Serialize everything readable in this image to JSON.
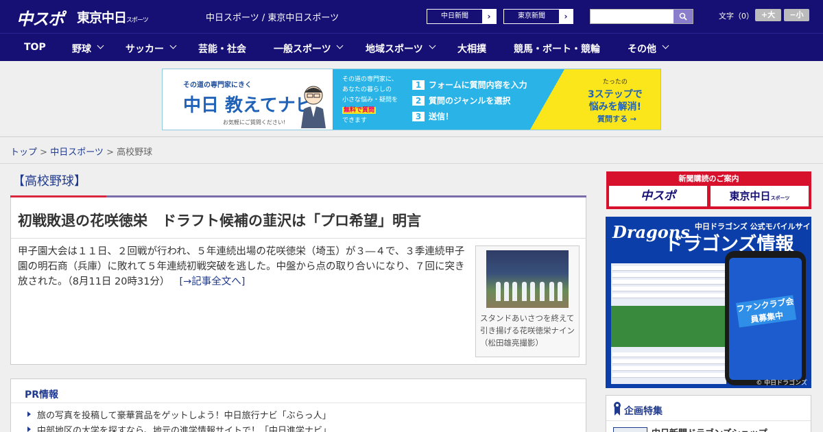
{
  "header": {
    "logo_chunichi": "中スポ",
    "logo_tokyo": "東京中日",
    "logo_tokyo_small": "スポーツ",
    "site_links": "中日スポーツ / 東京中日スポーツ",
    "paper_links": [
      {
        "label": "中日新聞",
        "arrow": "›"
      },
      {
        "label": "東京新聞",
        "arrow": "›"
      }
    ],
    "search_placeholder": "",
    "text_size_label": "文字（0）",
    "text_size_up": "+大",
    "text_size_down": "−小"
  },
  "nav": {
    "items": [
      {
        "label": "TOP"
      },
      {
        "label": "野球"
      },
      {
        "label": "サッカー"
      },
      {
        "label": "芸能・社会"
      },
      {
        "label": "一般スポーツ"
      },
      {
        "label": "地域スポーツ"
      },
      {
        "label": "大相撲"
      },
      {
        "label": "競馬・ボート・競輪"
      },
      {
        "label": "その他"
      }
    ]
  },
  "banner": {
    "small": "その道の専門家にきく",
    "big": "中日 教えてナビ",
    "note": "お気軽にご質問ください!",
    "mid1": "その道の専門家に、",
    "mid2": "あなたの暮らしの",
    "mid3": "小さな悩み・疑問を",
    "mid4": "無料で質問",
    "mid5": "できます",
    "steps": [
      {
        "n": "1",
        "text": "フォームに質問内容を入力"
      },
      {
        "n": "2",
        "text": "質問のジャンルを選択"
      },
      {
        "n": "3",
        "text": "送信！"
      }
    ],
    "right1": "たったの",
    "right2": "3ステップで",
    "right3": "悩みを解消!",
    "ask": "質問する →"
  },
  "breadcrumb": {
    "top": "トップ",
    "sep": " > ",
    "parent": "中日スポーツ",
    "current": "高校野球"
  },
  "section": {
    "title": "【高校野球】"
  },
  "article": {
    "title": "初戦敗退の花咲徳栄　ドラフト候補の韮沢は「プロ希望」明言",
    "body": "甲子園大会は１１日、２回戦が行われ、５年連続出場の花咲徳栄（埼玉）が３―４で、３季連続甲子園の明石商（兵庫）に敗れて５年連続初戦突破を逃した。中盤から点の取り合いになり、７回に突き放された。（8月11日 20時31分）",
    "more_link": "[→記事全文へ]",
    "photo_caption": "スタンドあいさつを終えて引き揚げる花咲徳栄ナイン（松田雄亮撮影）"
  },
  "pr": {
    "title": "PR情報",
    "items": [
      "旅の写真を投稿して豪華賞品をゲットしよう！中日旅行ナビ「ぶらっ人」",
      "中部地区の大学を探すなら、地元の進学情報サイトで！「中日進学ナビ」"
    ]
  },
  "sidebar": {
    "subscribe_title": "新聞購読のご案内",
    "subscribe_btn1": "中スポ",
    "subscribe_btn2": "東京中日",
    "subscribe_btn2_small": "スポーツ",
    "dragons_logo": "Dragons",
    "dragons_t1": "中日ドラゴンズ 公式モバイルサイト",
    "dragons_t2": "ドラゴンズ情報",
    "dragons_badge": "ファンクラブ会員募集中",
    "dragons_foot": "© 中日ドラゴンズ",
    "kikaku_title": "企画特集",
    "kikaku_item": "中日新聞ドラゴンズショップ"
  },
  "colors": {
    "header_bg": "#161075",
    "accent_red": "#d7263d",
    "link": "#1f3a8f"
  }
}
